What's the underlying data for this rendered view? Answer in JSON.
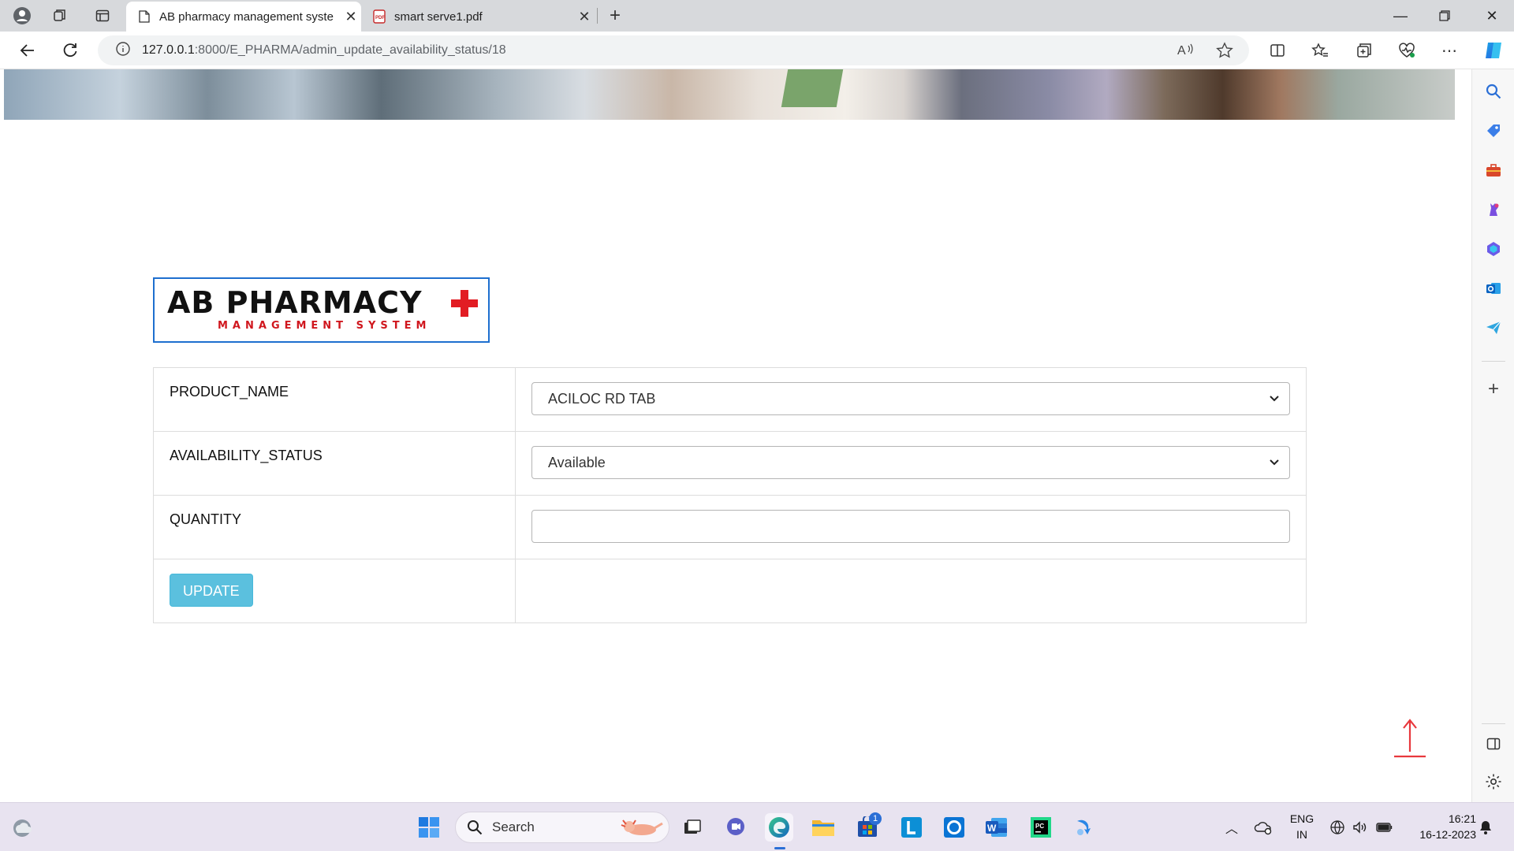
{
  "browser": {
    "tabs": [
      {
        "title": "AB pharmacy management syste",
        "active": true
      },
      {
        "title": "smart serve1.pdf",
        "active": false
      }
    ],
    "url_host": "127.0.0.1",
    "url_path": ":8000/E_PHARMA/admin_update_availability_status/18"
  },
  "logo": {
    "line1": "AB PHARMACY",
    "line2": "MANAGEMENT SYSTEM",
    "colors": {
      "text": "#111111",
      "accent": "#e21c23",
      "border": "#1e6fcf"
    }
  },
  "form": {
    "product_label": "PRODUCT_NAME",
    "product_value": "ACILOC RD TAB",
    "availability_label": "AVAILABILITY_STATUS",
    "availability_value": "Available",
    "quantity_label": "QUANTITY",
    "quantity_value": "",
    "update_button": "UPDATE",
    "button_color": "#5bc0de"
  },
  "taskbar": {
    "search_label": "Search",
    "store_badge": "1",
    "lang_line1": "ENG",
    "lang_line2": "IN",
    "time": "16:21",
    "date": "16-12-2023"
  }
}
